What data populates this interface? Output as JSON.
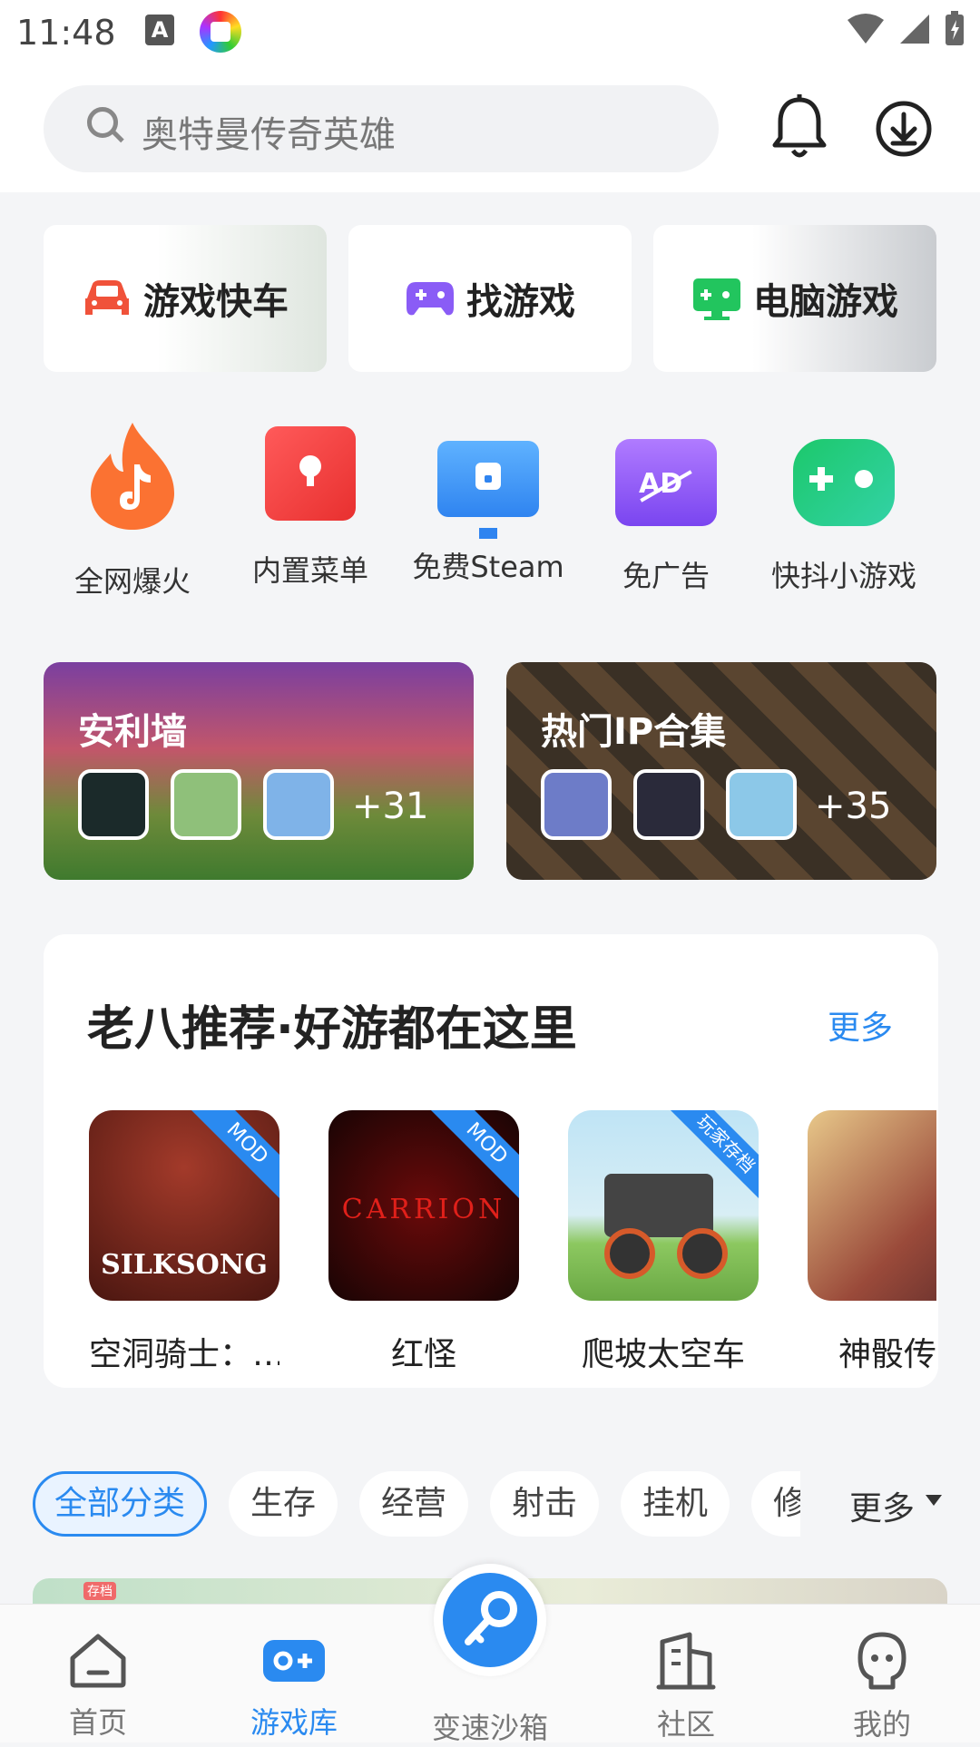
{
  "status": {
    "time": "11:48",
    "a_icon": "A"
  },
  "search": {
    "placeholder": "奥特曼传奇英雄"
  },
  "top_cards": [
    {
      "label": "游戏快车",
      "icon": "car-icon",
      "color": "#f0523a"
    },
    {
      "label": "找游戏",
      "icon": "gamepad-icon",
      "color": "#8a5cf6"
    },
    {
      "label": "电脑游戏",
      "icon": "pc-gamepad-icon",
      "color": "#22c55e"
    }
  ],
  "grid": [
    {
      "label": "全网爆火",
      "icon": "fire-tiktok-icon"
    },
    {
      "label": "内置菜单",
      "icon": "menu-icon"
    },
    {
      "label": "免费Steam",
      "icon": "monitor-icon"
    },
    {
      "label": "免广告",
      "icon": "ad-block-icon"
    },
    {
      "label": "快抖小游戏",
      "icon": "gamepad-icon"
    }
  ],
  "banners": [
    {
      "title": "安利墙",
      "count": "+31"
    },
    {
      "title": "热门IP合集",
      "count": "+35"
    }
  ],
  "recommend": {
    "title": "老八推荐·好游都在这里",
    "more": "更多",
    "games": [
      {
        "name": "空洞骑士：…",
        "ribbon": "MOD",
        "art": "SILKSONG"
      },
      {
        "name": "红怪",
        "ribbon": "MOD",
        "art": "CARRION"
      },
      {
        "name": "爬坡太空车",
        "ribbon": "玩家存档",
        "art": ""
      },
      {
        "name": "神骰传",
        "ribbon": "",
        "art": ""
      }
    ]
  },
  "categories": {
    "items": [
      "全部分类",
      "生存",
      "经营",
      "射击",
      "挂机",
      "修"
    ],
    "active": "全部分类",
    "more": "更多"
  },
  "list_preview": {
    "badge": "存档"
  },
  "nav": {
    "items": [
      {
        "label": "首页",
        "icon": "home-icon"
      },
      {
        "label": "游戏库",
        "icon": "game-library-icon"
      },
      {
        "label": "变速沙箱",
        "icon": "key-icon"
      },
      {
        "label": "社区",
        "icon": "community-icon"
      },
      {
        "label": "我的",
        "icon": "profile-icon"
      }
    ],
    "active": "游戏库"
  },
  "colors": {
    "accent": "#2a8af0",
    "background": "#f4f5f7"
  }
}
